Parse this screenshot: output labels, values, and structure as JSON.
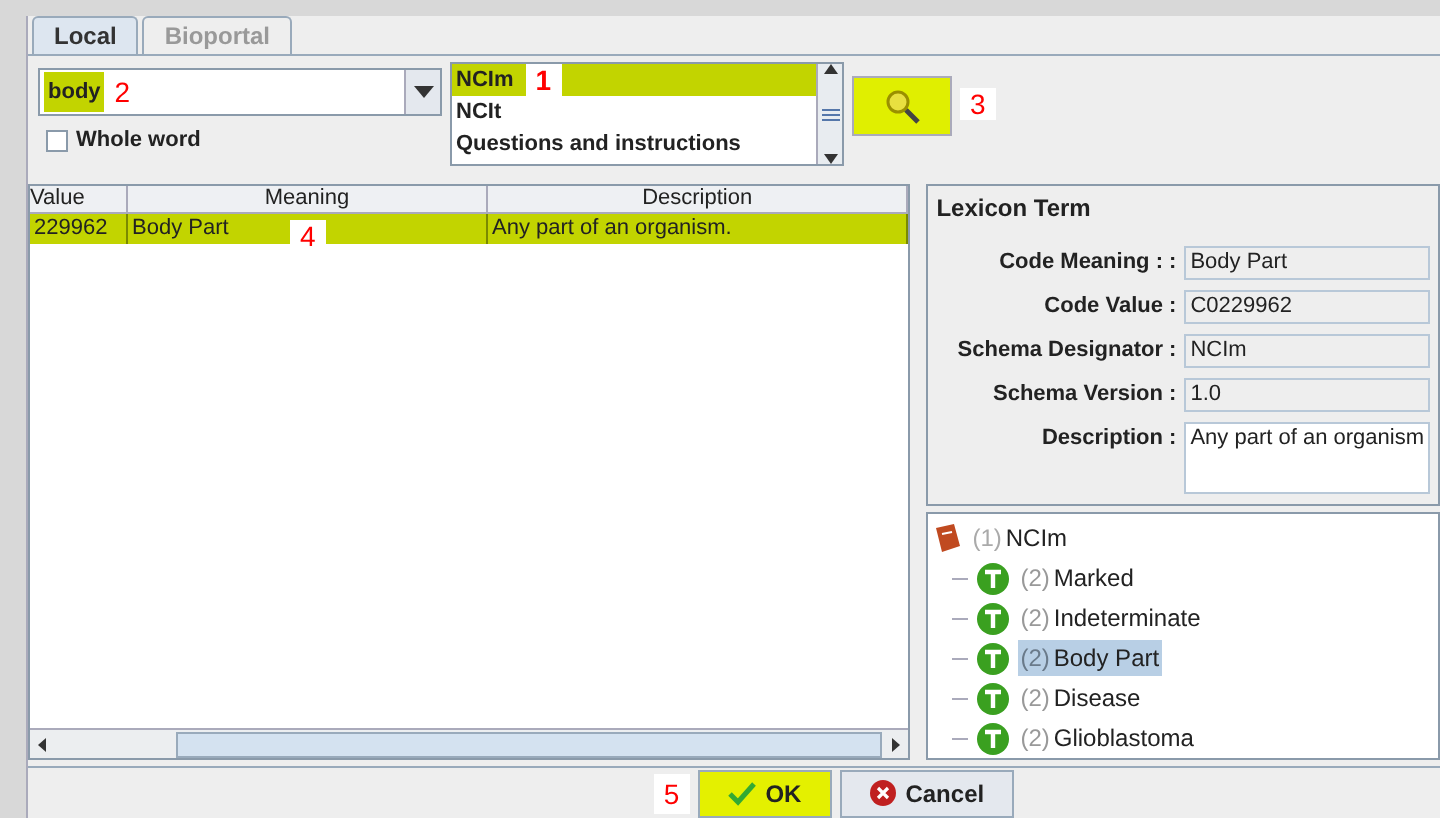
{
  "tabs": [
    {
      "label": "Local",
      "selected": true
    },
    {
      "label": "Bioportal",
      "selected": false
    }
  ],
  "search": {
    "value": "body",
    "highlighted": true,
    "callout": "2"
  },
  "whole_word": {
    "label": "Whole word",
    "checked": false
  },
  "lexicons": {
    "callout": "1",
    "items": [
      {
        "label": "NCIm",
        "selected": true
      },
      {
        "label": "NCIt",
        "selected": false
      },
      {
        "label": "Questions and instructions",
        "selected": false
      }
    ]
  },
  "search_button": {
    "highlighted": true,
    "callout": "3"
  },
  "table": {
    "columns": [
      "Value",
      "Meaning",
      "Description"
    ],
    "callout": "4",
    "rows": [
      {
        "cells": [
          "229962",
          "Body Part",
          "Any part of an organism."
        ],
        "selected": true
      }
    ]
  },
  "lexicon_term": {
    "title": "Lexicon Term",
    "fields": [
      {
        "label": "Code Meaning : :",
        "value": "Body Part",
        "kind": "line"
      },
      {
        "label": "Code Value :",
        "value": "C0229962",
        "kind": "line"
      },
      {
        "label": "Schema Designator :",
        "value": "NCIm",
        "kind": "line"
      },
      {
        "label": "Schema Version :",
        "value": "1.0",
        "kind": "line"
      },
      {
        "label": "Description :",
        "value": "Any part of an organism",
        "kind": "area"
      }
    ]
  },
  "tree": {
    "count": "(1)",
    "label": "NCIm",
    "children": [
      {
        "count": "(2)",
        "label": "Marked",
        "selected": false
      },
      {
        "count": "(2)",
        "label": "Indeterminate",
        "selected": false
      },
      {
        "count": "(2)",
        "label": "Body Part",
        "selected": true
      },
      {
        "count": "(2)",
        "label": "Disease",
        "selected": false
      },
      {
        "count": "(2)",
        "label": "Glioblastoma",
        "selected": false
      }
    ]
  },
  "buttons": [
    {
      "label": "OK",
      "kind": "ok",
      "highlighted": true,
      "callout": "5"
    },
    {
      "label": "Cancel",
      "kind": "cancel",
      "highlighted": false
    }
  ]
}
